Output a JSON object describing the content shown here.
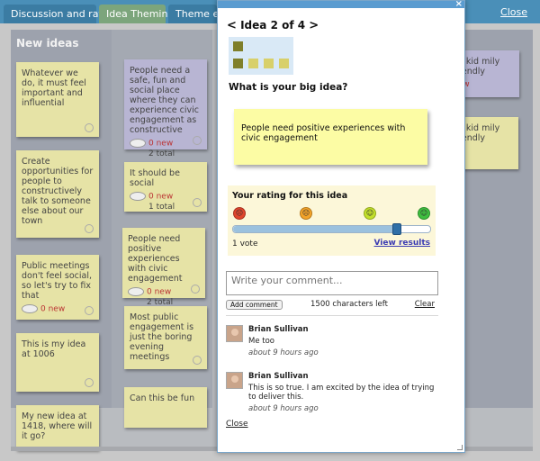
{
  "tabs": [
    {
      "label": "Discussion and rating"
    },
    {
      "label": "Idea Theming"
    },
    {
      "label": "Theme edit"
    }
  ],
  "tabbar_close": "Close",
  "column_title": "New ideas",
  "notes_col1": [
    {
      "text": "Whatever we do, it must feel important and influential"
    },
    {
      "text": "Create opportunities for people to constructively talk to someone else about our town"
    },
    {
      "text": "Public meetings don't feel social, so let's try to fix that",
      "new": "0 new"
    },
    {
      "text": "This is my idea at 1006"
    },
    {
      "text": "My new idea at 1418, where will it go?"
    }
  ],
  "notes_col2": [
    {
      "text": "People need a safe, fun and social place where they can experience civic engagement as constructive",
      "new": "0 new",
      "total": "2 total"
    },
    {
      "text": "It should be social",
      "new": "0 new",
      "total": "1 total"
    },
    {
      "text": "People need positive experiences with civic engagement",
      "new": "0 new",
      "total": "2 total"
    },
    {
      "text": "Most public engagement is just the boring evening meetings"
    },
    {
      "text": "Can this be fun"
    }
  ],
  "notes_col3": [
    {
      "text": "be kid mily friendly",
      "new": "new",
      "total": "l"
    },
    {
      "text": "be kid mily friendly"
    }
  ],
  "modal": {
    "close_x": "×",
    "nav_prev": "<",
    "nav_title": "Idea 2 of 4",
    "nav_next": ">",
    "question": "What is your big idea?",
    "idea_text": "People need positive experiences with civic engagement",
    "rating": {
      "title": "Your rating for this idea",
      "value": 0.83,
      "vote_count": "1 vote",
      "view_results": "View results"
    },
    "comment_placeholder": "Write your comment...",
    "add_comment": "Add comment",
    "chars_left": "1500 characters left",
    "clear": "Clear",
    "comments": [
      {
        "name": "Brian Sullivan",
        "text": "Me too",
        "time": "about 9 hours ago"
      },
      {
        "name": "Brian Sullivan",
        "text": "This is so true. I am excited by the idea of trying to deliver this.",
        "time": "about 9 hours ago"
      }
    ],
    "close": "Close"
  },
  "colors": {
    "tabbar": "#4a8fb8",
    "active_tab": "#7ca57c",
    "note_yellow": "#e6e3a6",
    "note_purple": "#b8b5d3",
    "idea_note": "#fcfca4",
    "rating_bg": "#fcf7d9",
    "thumb_olive": "#7f7f2a",
    "thumb_yellow": "#d8d06a",
    "slider_knob": "#2f6fa7",
    "face_red": "#e0452d",
    "face_orange": "#f3a329",
    "face_yellowgreen": "#c3e02a",
    "face_green": "#3fbf3f"
  },
  "icons": {
    "rating_faces": [
      "angry-face-icon",
      "sad-face-icon",
      "neutral-face-icon",
      "happy-face-icon"
    ]
  }
}
